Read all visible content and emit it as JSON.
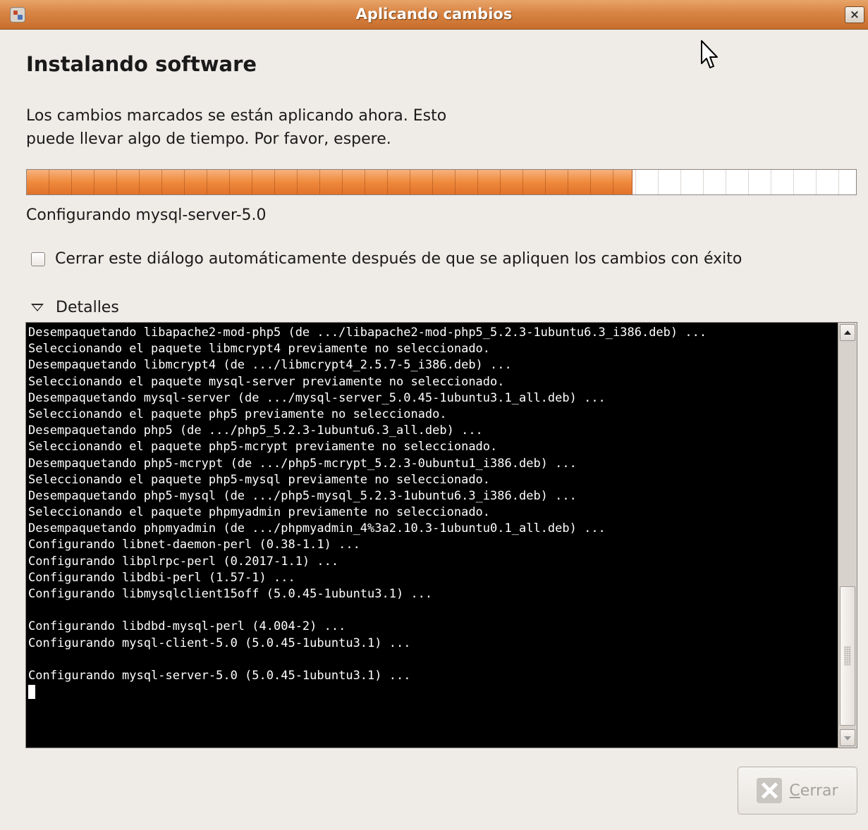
{
  "window": {
    "title": "Aplicando cambios",
    "close_glyph": "×"
  },
  "main": {
    "heading": "Instalando software",
    "description_line1": "Los cambios marcados se están aplicando ahora. Esto",
    "description_line2": "puede llevar algo de tiempo. Por favor, espere.",
    "progress_fraction": 0.73,
    "status": "Configurando mysql-server-5.0",
    "auto_close_checkbox": {
      "label": "Cerrar este diálogo automáticamente después de que se apliquen los cambios con éxito",
      "checked": false
    },
    "details": {
      "label": "Detalles",
      "expanded": true,
      "terminal_lines": [
        "Desempaquetando libapache2-mod-php5 (de .../libapache2-mod-php5_5.2.3-1ubuntu6.3_i386.deb) ...",
        "Seleccionando el paquete libmcrypt4 previamente no seleccionado.",
        "Desempaquetando libmcrypt4 (de .../libmcrypt4_2.5.7-5_i386.deb) ...",
        "Seleccionando el paquete mysql-server previamente no seleccionado.",
        "Desempaquetando mysql-server (de .../mysql-server_5.0.45-1ubuntu3.1_all.deb) ...",
        "Seleccionando el paquete php5 previamente no seleccionado.",
        "Desempaquetando php5 (de .../php5_5.2.3-1ubuntu6.3_all.deb) ...",
        "Seleccionando el paquete php5-mcrypt previamente no seleccionado.",
        "Desempaquetando php5-mcrypt (de .../php5-mcrypt_5.2.3-0ubuntu1_i386.deb) ...",
        "Seleccionando el paquete php5-mysql previamente no seleccionado.",
        "Desempaquetando php5-mysql (de .../php5-mysql_5.2.3-1ubuntu6.3_i386.deb) ...",
        "Seleccionando el paquete phpmyadmin previamente no seleccionado.",
        "Desempaquetando phpmyadmin (de .../phpmyadmin_4%3a2.10.3-1ubuntu0.1_all.deb) ...",
        "Configurando libnet-daemon-perl (0.38-1.1) ...",
        "Configurando libplrpc-perl (0.2017-1.1) ...",
        "Configurando libdbi-perl (1.57-1) ...",
        "Configurando libmysqlclient15off (5.0.45-1ubuntu3.1) ...",
        "",
        "Configurando libdbd-mysql-perl (4.004-2) ...",
        "Configurando mysql-client-5.0 (5.0.45-1ubuntu3.1) ...",
        "",
        "Configurando mysql-server-5.0 (5.0.45-1ubuntu3.1) ..."
      ]
    }
  },
  "footer": {
    "close_button": {
      "mnemonic": "C",
      "label_rest": "errar",
      "enabled": false,
      "icon": "close-x-icon"
    }
  },
  "colors": {
    "titlebar": "#d88444",
    "progress_fill": "#ef8a3c",
    "window_bg": "#efebe7",
    "terminal_bg": "#000000",
    "terminal_fg": "#ffffff"
  }
}
